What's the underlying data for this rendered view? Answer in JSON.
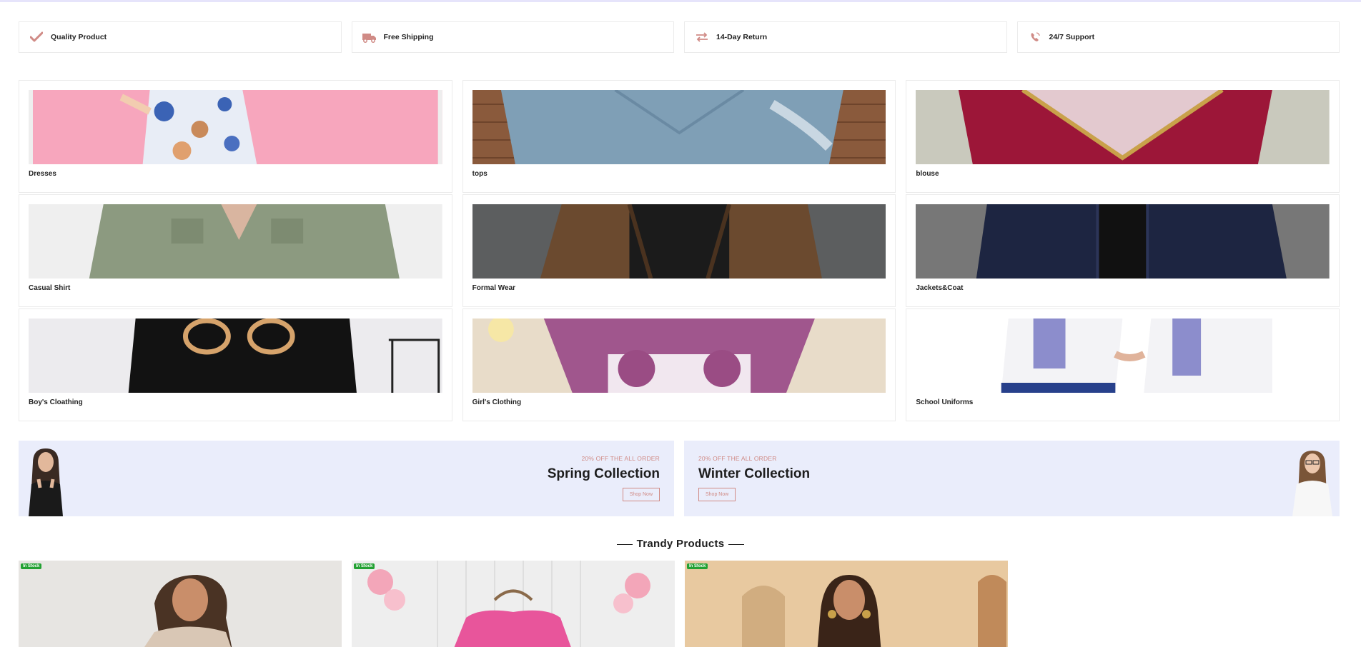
{
  "features": [
    {
      "label": "Quality Product",
      "icon": "check-icon"
    },
    {
      "label": "Free Shipping",
      "icon": "truck-icon"
    },
    {
      "label": "14-Day Return",
      "icon": "exchange-icon"
    },
    {
      "label": "24/7 Support",
      "icon": "phone-icon"
    }
  ],
  "categories": [
    {
      "label": "Dresses"
    },
    {
      "label": "tops"
    },
    {
      "label": "blouse"
    },
    {
      "label": "Casual Shirt"
    },
    {
      "label": "Formal Wear"
    },
    {
      "label": "Jackets&Coat"
    },
    {
      "label": "Boy's Cloathing"
    },
    {
      "label": "Girl's Clothing"
    },
    {
      "label": "School Uniforms"
    }
  ],
  "banners": [
    {
      "promo": "20% OFF THE ALL ORDER",
      "title": "Spring Collection",
      "button": "Shop Now"
    },
    {
      "promo": "20% OFF THE ALL ORDER",
      "title": "Winter Collection",
      "button": "Shop Now"
    }
  ],
  "trendy": {
    "title": "Trandy Products",
    "products": [
      {
        "badge": "In Stock"
      },
      {
        "badge": "In Stock"
      },
      {
        "badge": "In Stock"
      }
    ]
  },
  "colors": {
    "accent": "#d08b86",
    "banner_bg": "#eaedfb",
    "badge_green": "#23a133",
    "border": "#ebebeb"
  }
}
